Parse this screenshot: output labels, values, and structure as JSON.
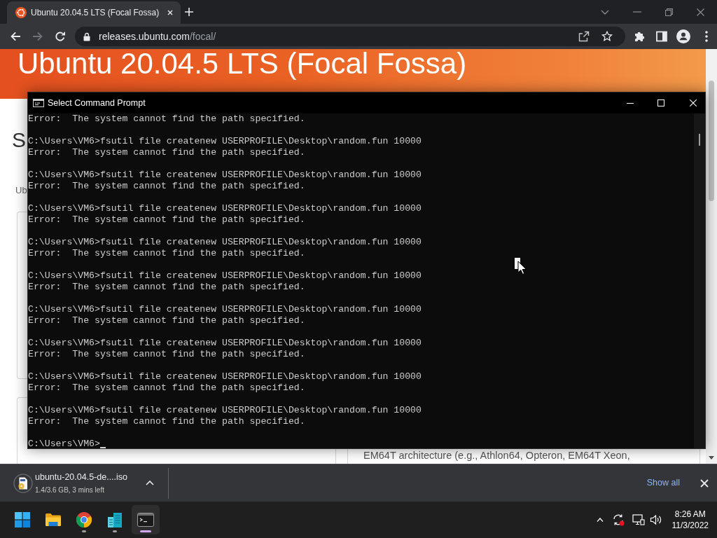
{
  "browser": {
    "tabs": [
      {
        "title": "Ubuntu 20.04.5 LTS (Focal Fossa)",
        "selected": true
      }
    ],
    "nav_buttons": [
      {
        "kind": "back",
        "disabled": false
      },
      {
        "kind": "forward",
        "disabled": true
      },
      {
        "kind": "reload",
        "disabled": false
      }
    ],
    "address_bar": {
      "host": "releases.ubuntu.com",
      "path": "/focal/"
    }
  },
  "page": {
    "title": "Ubuntu 20.04.5 LTS (Focal Fossa)",
    "heading": "S",
    "intro": "Ub",
    "card_text": "EM64T architecture (e.g., Athlon64, Opteron, EM64T Xeon,"
  },
  "console_window": {
    "title": "Select Command Prompt",
    "blocks": [
      [
        "Error:  The system cannot find the path specified."
      ],
      [
        "C:\\Users\\VM6>fsutil file createnew USERPROFILE\\Desktop\\random.fun 10000",
        "Error:  The system cannot find the path specified."
      ],
      [
        "C:\\Users\\VM6>fsutil file createnew USERPROFILE\\Desktop\\random.fun 10000",
        "Error:  The system cannot find the path specified."
      ],
      [
        "C:\\Users\\VM6>fsutil file createnew USERPROFILE\\Desktop\\random.fun 10000",
        "Error:  The system cannot find the path specified."
      ],
      [
        "C:\\Users\\VM6>fsutil file createnew USERPROFILE\\Desktop\\random.fun 10000",
        "Error:  The system cannot find the path specified."
      ],
      [
        "C:\\Users\\VM6>fsutil file createnew USERPROFILE\\Desktop\\random.fun 10000",
        "Error:  The system cannot find the path specified."
      ],
      [
        "C:\\Users\\VM6>fsutil file createnew USERPROFILE\\Desktop\\random.fun 10000",
        "Error:  The system cannot find the path specified."
      ],
      [
        "C:\\Users\\VM6>fsutil file createnew USERPROFILE\\Desktop\\random.fun 10000",
        "Error:  The system cannot find the path specified."
      ],
      [
        "C:\\Users\\VM6>fsutil file createnew USERPROFILE\\Desktop\\random.fun 10000",
        "Error:  The system cannot find the path specified."
      ],
      [
        "C:\\Users\\VM6>fsutil file createnew USERPROFILE\\Desktop\\random.fun 10000",
        "Error:  The system cannot find the path specified."
      ],
      [
        "C:\\Users\\VM6>"
      ]
    ]
  },
  "download_bar": {
    "items": [
      {
        "file_name": "ubuntu-20.04.5-de....iso",
        "status": "1.4/3.6 GB, 3 mins left"
      }
    ],
    "show_all": "Show all"
  },
  "taskbar": {
    "apps": [
      {
        "kind": "folder",
        "open": false,
        "selected": false
      },
      {
        "kind": "browser",
        "open": true,
        "selected": false
      },
      {
        "kind": "buildings",
        "open": true,
        "selected": false
      },
      {
        "kind": "console",
        "open": true,
        "selected": true
      }
    ],
    "time": "8:26 AM",
    "date": "11/3/2022"
  }
}
